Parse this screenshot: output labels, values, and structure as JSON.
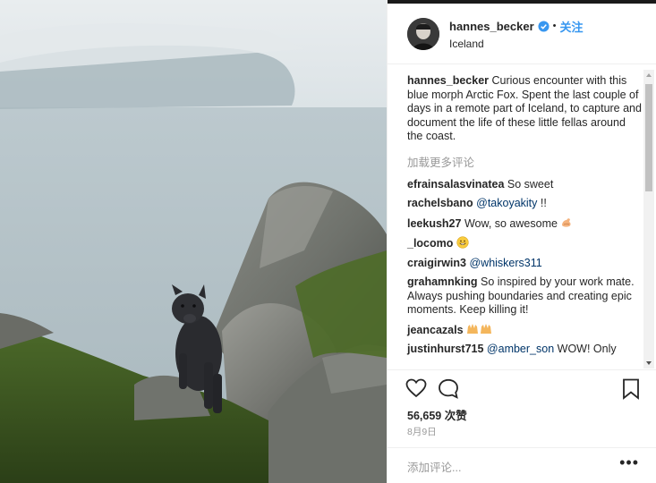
{
  "post": {
    "username": "hannes_becker",
    "follow_label": "关注",
    "location": "Iceland",
    "photo_alt": ""
  },
  "caption": {
    "username": "hannes_becker",
    "text": "Curious encounter with this blue morph Arctic Fox. Spent the last couple of days in a remote part of Iceland, to capture and document the life of these little fellas around the coast."
  },
  "load_more_label": "加载更多评论",
  "comments": [
    {
      "username": "efrainsalasvinatea",
      "text": "So sweet"
    },
    {
      "username": "rachelsbano",
      "mention": "@takoyakity",
      "text": "!!"
    },
    {
      "username": "leekush27",
      "text": "Wow, so awesome",
      "emoji": "flexed-biceps"
    },
    {
      "username": "_locomo",
      "text": "",
      "emoji": "grinning-face"
    },
    {
      "username": "craigirwin3",
      "mention": "@whiskers311",
      "text": ""
    },
    {
      "username": "grahamnking",
      "text": "So inspired by your work mate. Always pushing boundaries and creating epic moments. Keep killing it!"
    },
    {
      "username": "jeancazals",
      "text": "",
      "emoji": "raising-hands x2"
    },
    {
      "username": "justinhurst715",
      "mention": "@amber_son",
      "text": "WOW! Only"
    }
  ],
  "likes": "56,659 次赞",
  "date": "8月9日",
  "add_comment_placeholder": "添加评论...",
  "icons": [
    "verified-badge-icon",
    "heart-icon",
    "comment-icon",
    "bookmark-icon",
    "ellipsis-icon"
  ],
  "colors": {
    "link": "#3897f0",
    "mention": "#003569",
    "muted": "#999999",
    "verified": "#3897f0"
  }
}
